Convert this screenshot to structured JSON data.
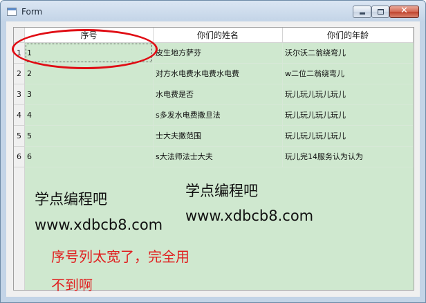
{
  "window": {
    "title": "Form",
    "title_icon": "app-window-icon"
  },
  "controls": {
    "minimize": "minimize-icon",
    "maximize": "maximize-icon",
    "close": "✕"
  },
  "table": {
    "columns": [
      "序号",
      "你们的姓名",
      "你们的年龄"
    ],
    "rows": [
      {
        "header": "1",
        "cells": [
          "1",
          "皮生地方萨芬",
          "沃尔沃二翁绕弯儿"
        ]
      },
      {
        "header": "2",
        "cells": [
          "2",
          "对方水电费水电费水电费",
          "w二位二翁绕弯儿"
        ]
      },
      {
        "header": "3",
        "cells": [
          "3",
          "水电费是否",
          "玩儿玩儿玩儿玩儿"
        ]
      },
      {
        "header": "4",
        "cells": [
          "4",
          "s多发水电费撒旦法",
          "玩儿玩儿玩儿玩儿"
        ]
      },
      {
        "header": "5",
        "cells": [
          "5",
          "士大夫撒范围",
          "玩儿玩儿玩儿玩儿"
        ]
      },
      {
        "header": "6",
        "cells": [
          "6",
          "s大法师法士大夫",
          "玩儿完14服务认为认为"
        ]
      }
    ],
    "background_color": "#cfe8cf"
  },
  "watermarks": {
    "left": {
      "line1": "学点编程吧",
      "line2": "www.xdbcb8.com"
    },
    "right": {
      "line1": "学点编程吧",
      "line2": "www.xdbcb8.com"
    }
  },
  "annotation": {
    "line1": "序号列太宽了，完全用",
    "line2": "不到啊",
    "color": "#e02020"
  }
}
